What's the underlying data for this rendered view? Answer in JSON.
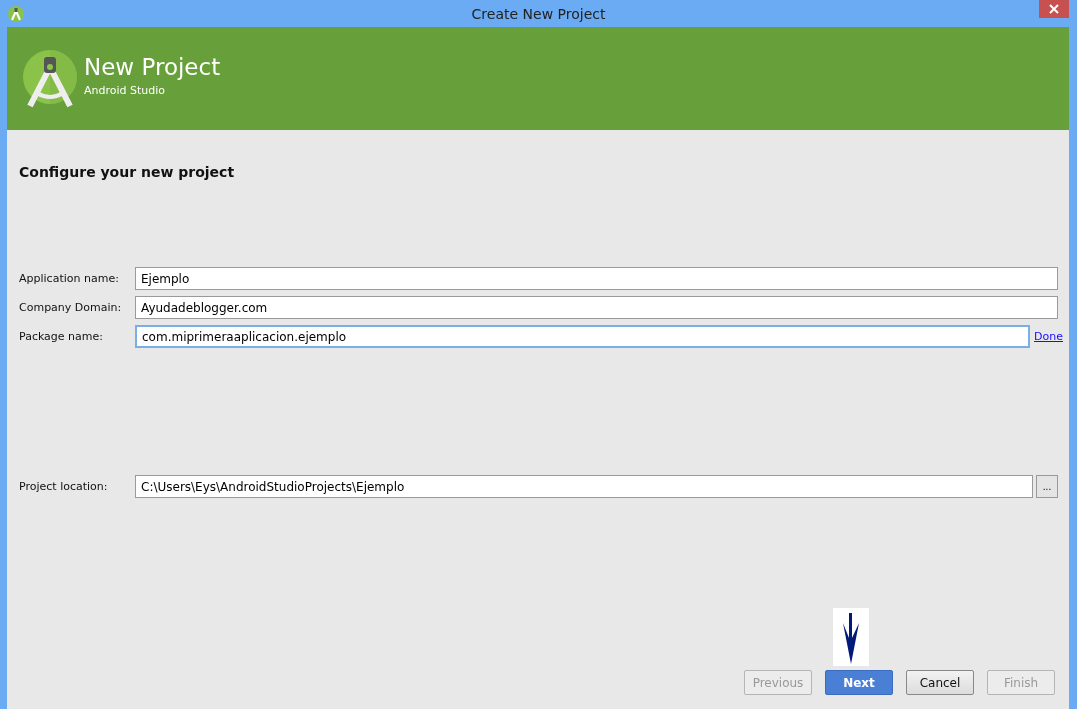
{
  "window": {
    "title": "Create New Project"
  },
  "header": {
    "title": "New Project",
    "subtitle": "Android Studio"
  },
  "heading": "Configure your new project",
  "fields": [
    {
      "label": "Application name:",
      "value": "Ejemplo",
      "focused": false
    },
    {
      "label": "Company Domain:",
      "value": "Ayudadeblogger.com",
      "focused": false
    },
    {
      "label": "Package name:",
      "value": "com.miprimeraaplicacion.ejemplo",
      "focused": true,
      "link": "Done"
    }
  ],
  "location": {
    "label": "Project location:",
    "value": "C:\\Users\\Eys\\AndroidStudioProjects\\Ejemplo",
    "browse": "..."
  },
  "buttons": [
    {
      "label": "Previous",
      "disabled": true,
      "primary": false
    },
    {
      "label": "Next",
      "disabled": false,
      "primary": true
    },
    {
      "label": "Cancel",
      "disabled": false,
      "primary": false
    },
    {
      "label": "Finish",
      "disabled": true,
      "primary": false
    }
  ]
}
